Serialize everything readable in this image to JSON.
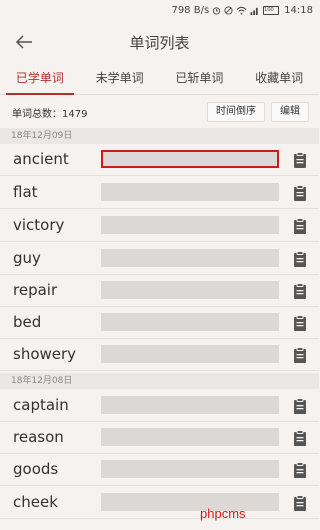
{
  "status": {
    "speed": "798 B/s",
    "battery": "100",
    "time": "14:18"
  },
  "header": {
    "title": "单词列表"
  },
  "tabs": [
    {
      "label": "已学单词",
      "active": true
    },
    {
      "label": "未学单词",
      "active": false
    },
    {
      "label": "已斩单词",
      "active": false
    },
    {
      "label": "收藏单词",
      "active": false
    }
  ],
  "summary": {
    "count_text": "单词总数：1479",
    "sort_label": "时间倒序",
    "edit_label": "编辑"
  },
  "groups": [
    {
      "date": "18年12月09日",
      "words": [
        "ancient",
        "flat",
        "victory",
        "guy",
        "repair",
        "bed",
        "showery"
      ]
    },
    {
      "date": "18年12月08日",
      "words": [
        "captain",
        "reason",
        "goods",
        "cheek"
      ]
    }
  ],
  "watermark": "phpcms",
  "colors": {
    "accent": "#b5302d",
    "selection": "#d0191c"
  }
}
